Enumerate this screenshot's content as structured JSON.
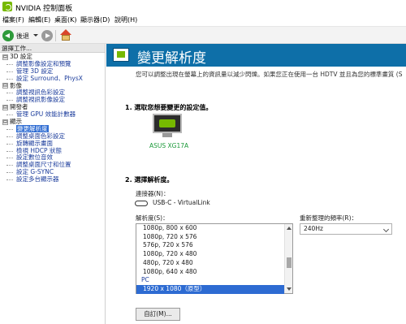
{
  "window": {
    "title": "NVIDIA 控制面板"
  },
  "menu": [
    "檔案(F)",
    "編輯(E)",
    "桌面(K)",
    "顯示器(D)",
    "說明(H)"
  ],
  "toolbar": {
    "back_label": "後退"
  },
  "sidebar": {
    "header": "選擇工作...",
    "tree": [
      {
        "type": "cat",
        "expander": "⊟",
        "label": "3D 設定"
      },
      {
        "type": "item",
        "label": "調整影像設定和預覽"
      },
      {
        "type": "item",
        "label": "管理 3D 設定"
      },
      {
        "type": "item",
        "label": "設定 Surround、PhysX"
      },
      {
        "type": "cat",
        "expander": "⊟",
        "label": "影像"
      },
      {
        "type": "item",
        "label": "調整視訊色彩設定"
      },
      {
        "type": "item",
        "label": "調整視訊影像設定"
      },
      {
        "type": "cat",
        "expander": "⊟",
        "label": "開發者"
      },
      {
        "type": "item",
        "label": "管理 GPU 效能計數器"
      },
      {
        "type": "cat",
        "expander": "⊟",
        "label": "顯示"
      },
      {
        "type": "item",
        "label": "變更解析度",
        "selected": true
      },
      {
        "type": "item",
        "label": "調整桌面色彩設定"
      },
      {
        "type": "item",
        "label": "旋轉顯示畫面"
      },
      {
        "type": "item",
        "label": "檢視 HDCP 狀態"
      },
      {
        "type": "item",
        "label": "設定數位音效"
      },
      {
        "type": "item",
        "label": "調整桌面尺寸和位置"
      },
      {
        "type": "item",
        "label": "設定 G-SYNC"
      },
      {
        "type": "item",
        "label": "設定多台顯示器"
      }
    ]
  },
  "main": {
    "title": "變更解析度",
    "description": "您可以調整出現在螢幕上的資訊量以減少閃爍。如果您正在使用一台 HDTV 並且為您的標準畫質 (S",
    "section1": {
      "num": "1.",
      "label": "選取您想要變更的設定值。"
    },
    "monitor_name": "ASUS XG17A",
    "section2": {
      "num": "2.",
      "label": "選擇解析度。"
    },
    "connector_label": "連接器(N)：",
    "connector_value": "USB-C - VirtualLink",
    "resolution_label": "解析度(S)：",
    "refresh_label": "重新整理的頻率(R)：",
    "refresh_value": "240Hz",
    "resolutions": [
      {
        "label": "1080p, 800 x 600",
        "kind": "item"
      },
      {
        "label": "1080p, 720 x 576",
        "kind": "item"
      },
      {
        "label": "576p, 720 x 576",
        "kind": "item"
      },
      {
        "label": "1080p, 720 x 480",
        "kind": "item"
      },
      {
        "label": "480p, 720 x 480",
        "kind": "item"
      },
      {
        "label": "1080p, 640 x 480",
        "kind": "item"
      },
      {
        "label": "PC",
        "kind": "group"
      },
      {
        "label": "1920 x 1080（原型）",
        "kind": "selected"
      }
    ],
    "custom_button": "自訂(M)..."
  }
}
